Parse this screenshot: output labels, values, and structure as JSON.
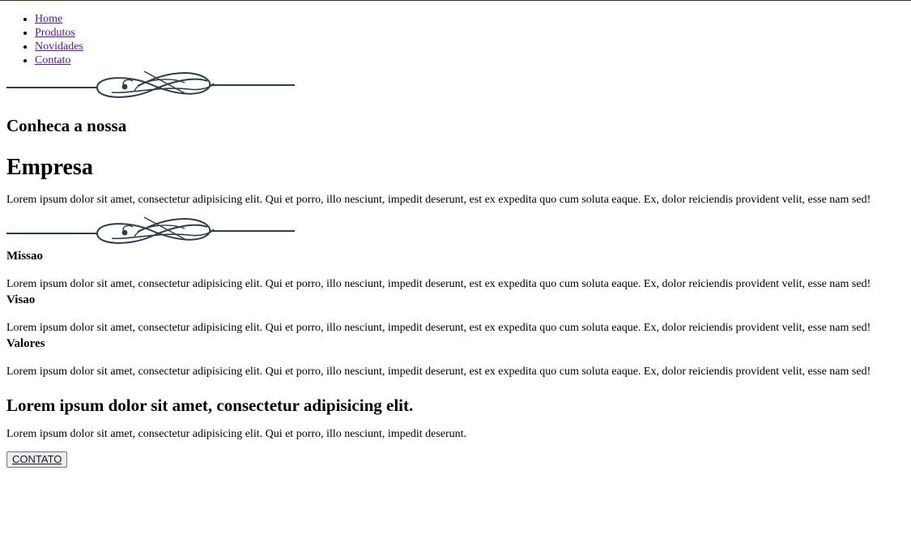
{
  "nav": {
    "items": [
      {
        "label": "Home"
      },
      {
        "label": "Produtos"
      },
      {
        "label": "Novidades"
      },
      {
        "label": "Contato"
      }
    ]
  },
  "about": {
    "lead": "Conheca a nossa",
    "title": "Empresa",
    "text": "Lorem ipsum dolor sit amet, consectetur adipisicing elit. Qui et porro, illo nesciunt, impedit deserunt, est ex expedita quo cum soluta eaque. Ex, dolor reiciendis provident velit, esse nam sed!"
  },
  "sections": [
    {
      "title": "Missao",
      "text": "Lorem ipsum dolor sit amet, consectetur adipisicing elit. Qui et porro, illo nesciunt, impedit deserunt, est ex expedita quo cum soluta eaque. Ex, dolor reiciendis provident velit, esse nam sed!"
    },
    {
      "title": "Visao",
      "text": "Lorem ipsum dolor sit amet, consectetur adipisicing elit. Qui et porro, illo nesciunt, impedit deserunt, est ex expedita quo cum soluta eaque. Ex, dolor reiciendis provident velit, esse nam sed!"
    },
    {
      "title": "Valores",
      "text": "Lorem ipsum dolor sit amet, consectetur adipisicing elit. Qui et porro, illo nesciunt, impedit deserunt, est ex expedita quo cum soluta eaque. Ex, dolor reiciendis provident velit, esse nam sed!"
    }
  ],
  "cta": {
    "heading": "Lorem ipsum dolor sit amet, consectetur adipisicing elit.",
    "text": "Lorem ipsum dolor sit amet, consectetur adipisicing elit. Qui et porro, illo nesciunt, impedit deserunt.",
    "button_label": "CONTATO"
  },
  "colors": {
    "ornament": "#2c3e48",
    "link": "#551a8b"
  },
  "icons": {
    "divider": "flourish-divider-icon"
  }
}
